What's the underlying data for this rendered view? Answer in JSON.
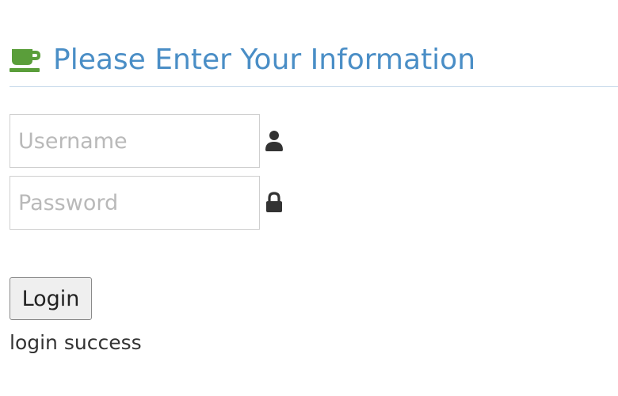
{
  "header": {
    "title": "Please Enter Your Information",
    "icon": "coffee-cup-icon",
    "icon_color": "#5a9e3a",
    "title_color": "#4a8ec6"
  },
  "form": {
    "username": {
      "value": "",
      "placeholder": "Username",
      "icon": "user-icon"
    },
    "password": {
      "value": "",
      "placeholder": "Password",
      "icon": "lock-icon"
    },
    "login_label": "Login"
  },
  "status": {
    "message": "login success"
  }
}
